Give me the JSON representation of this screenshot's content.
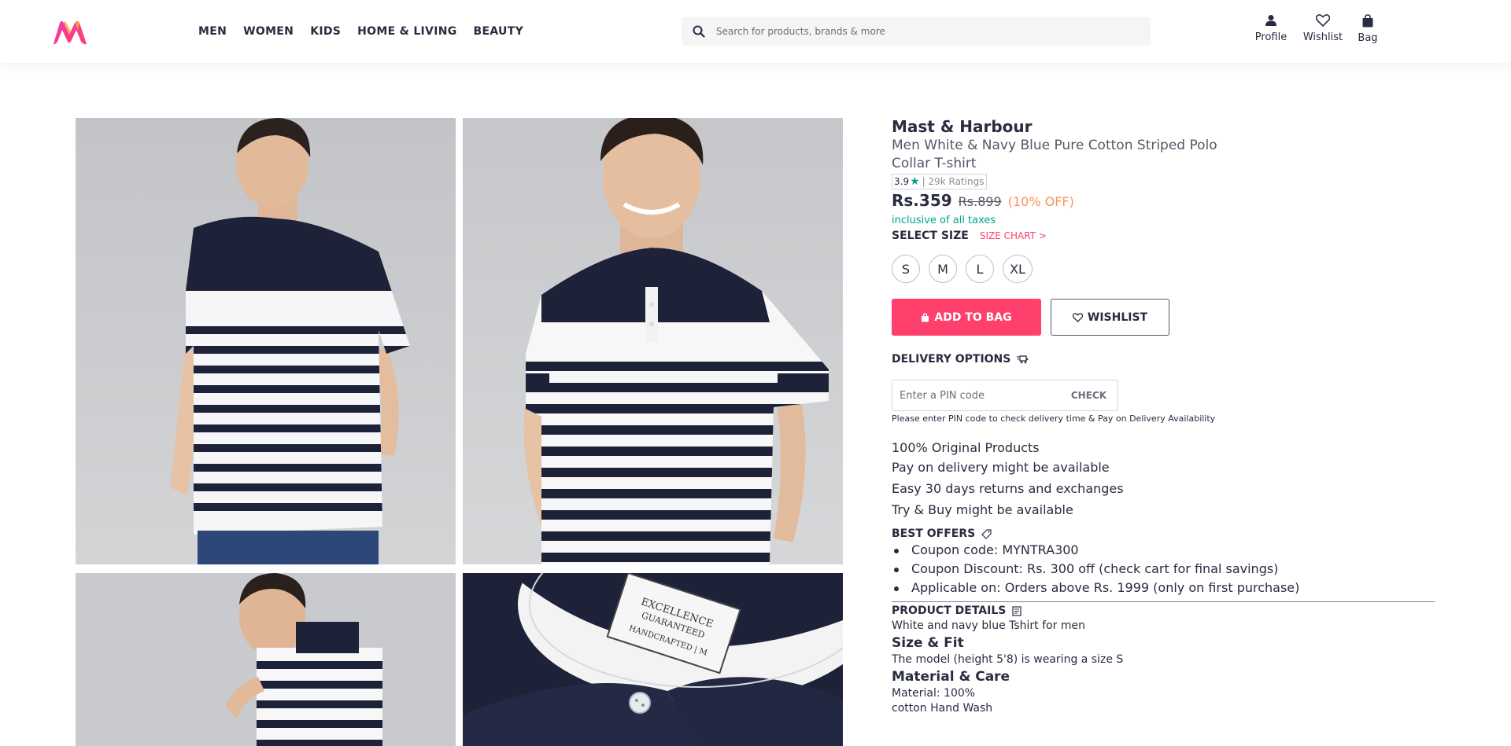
{
  "header": {
    "nav": [
      "MEN",
      "WOMEN",
      "KIDS",
      "HOME & LIVING",
      "BEAUTY"
    ],
    "search_placeholder": "Search for products, brands & more",
    "profile_label": "Profile",
    "wishlist_label": "Wishlist",
    "bag_label": "Bag",
    "brand_colors": [
      "#ff3f6c",
      "#f13ab1",
      "#ff905a",
      "#fdb614"
    ]
  },
  "product": {
    "brand": "Mast & Harbour",
    "name": "Men White & Navy Blue Pure Cotton Striped Polo Collar T-shirt",
    "rating": "3.9",
    "rating_star": "★",
    "rating_count": "| 29k Ratings",
    "price": "Rs.359",
    "mrp": "Rs.899",
    "discount": "(10% OFF)",
    "tax_note": "inclusive of all taxes",
    "select_size": "SELECT SIZE",
    "size_chart": "SIZE CHART >",
    "sizes": [
      "S",
      "M",
      "L",
      "XL"
    ],
    "add_to_bag": "ADD TO BAG",
    "wishlist": "WISHLIST",
    "delivery_title": "DELIVERY OPTIONS",
    "pin_placeholder": "Enter a PIN code",
    "pin_check": "CHECK",
    "pin_note": "Please enter PIN code to check delivery time & Pay on Delivery Availability",
    "assurances": [
      "100% Original Products",
      "Pay on delivery might be available",
      "Easy 30 days returns and exchanges",
      "Try & Buy might be available"
    ],
    "offers_title": "BEST OFFERS",
    "offers": [
      "Coupon code: MYNTRA300",
      "Coupon Discount: Rs. 300 off (check cart for final savings)",
      "Applicable on: Orders above Rs. 1999 (only on first purchase)"
    ],
    "details_title": "PRODUCT DETAILS",
    "details_text": "White and navy blue Tshirt for men",
    "size_fit_title": "Size & Fit",
    "size_fit_text": "The model (height 5'8) is wearing a size S",
    "material_title": "Material & Care",
    "material_text_1": "Material: 100%",
    "material_text_2": "cotton Hand Wash"
  },
  "colors": {
    "accent": "#ff3f6c",
    "discount": "#ff905a",
    "tax": "#03a685",
    "shirt_navy": "#1d2238",
    "shirt_white": "#f7f7f8",
    "photo_bg": "#c9cacd"
  }
}
